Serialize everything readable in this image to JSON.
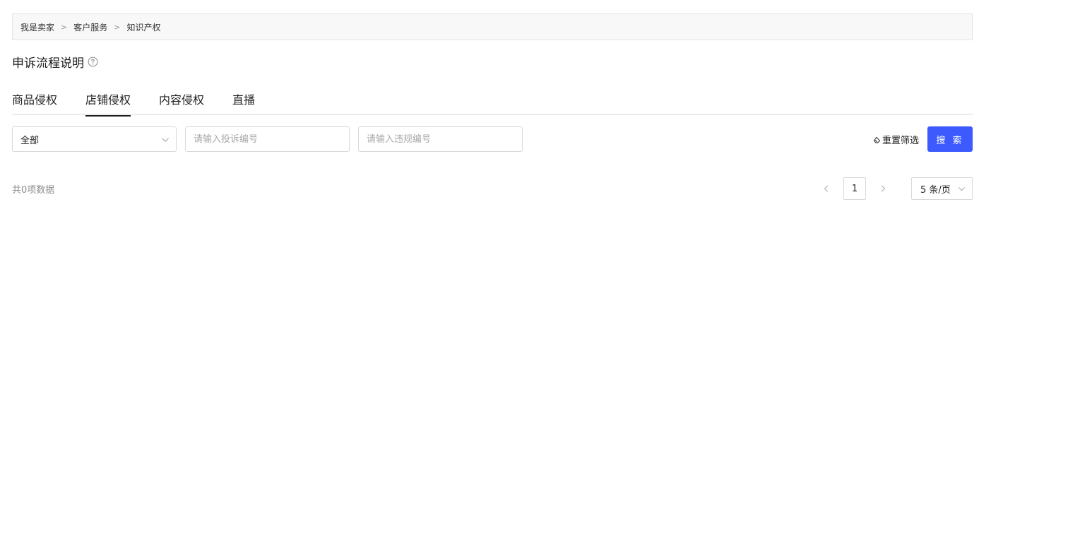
{
  "breadcrumb": {
    "items": [
      "我是卖家",
      "客户服务",
      "知识产权"
    ],
    "separator": ">"
  },
  "page": {
    "title": "申诉流程说明",
    "help_icon": "question-circle-icon"
  },
  "tabs": {
    "items": [
      {
        "label": "商品侵权",
        "active": false
      },
      {
        "label": "店铺侵权",
        "active": true
      },
      {
        "label": "内容侵权",
        "active": false
      },
      {
        "label": "直播",
        "active": false
      }
    ]
  },
  "filters": {
    "status_select": {
      "value": "全部",
      "icon": "chevron-down-icon"
    },
    "complaint_input": {
      "value": "",
      "placeholder": "请输入投诉编号"
    },
    "violation_input": {
      "value": "",
      "placeholder": "请输入违规编号"
    },
    "reset_label": "重置筛选",
    "reset_icon": "eraser-icon",
    "search_label": "搜 索"
  },
  "results": {
    "total_text": "共0项数据"
  },
  "pagination": {
    "current_page": "1",
    "page_size_label": "5 条/页",
    "prev_icon": "chevron-left-icon",
    "next_icon": "chevron-right-icon"
  },
  "colors": {
    "primary": "#3d5afe",
    "border": "#d9d9d9",
    "muted_text": "#8c8c8c"
  }
}
